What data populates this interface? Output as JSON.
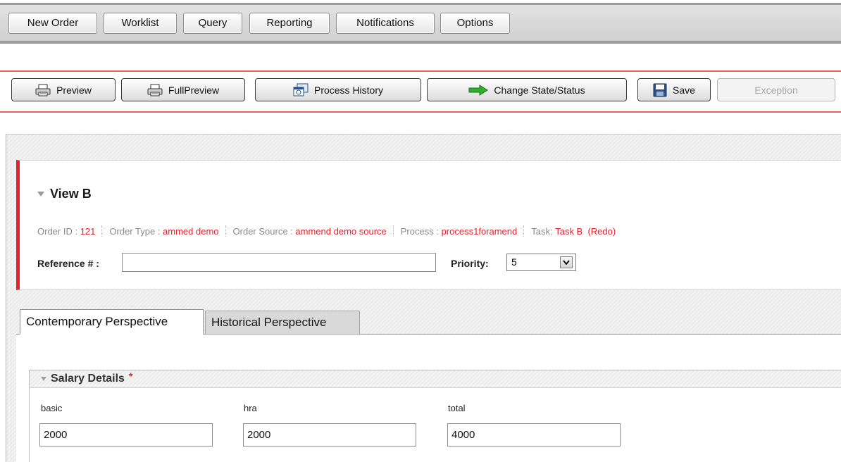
{
  "nav": {
    "tabs": [
      "New Order",
      "Worklist",
      "Query",
      "Reporting",
      "Notifications",
      "Options"
    ]
  },
  "toolbar": {
    "preview": "Preview",
    "full_preview": "FullPreview",
    "process_history": "Process History",
    "change_state": "Change State/Status",
    "save": "Save",
    "exception": "Exception"
  },
  "view": {
    "title": "View B",
    "order_id_label": "Order ID :",
    "order_id": "121",
    "order_type_label": "Order Type :",
    "order_type": "ammed demo",
    "order_source_label": "Order Source :",
    "order_source": "ammend demo source",
    "process_label": "Process :",
    "process": "process1foramend",
    "task_label": "Task:",
    "task": "Task B  (Redo)",
    "reference_label": "Reference # :",
    "reference_value": "",
    "priority_label": "Priority:",
    "priority_value": "5"
  },
  "tabs": {
    "contemporary": "Contemporary Perspective",
    "historical": "Historical Perspective"
  },
  "salary": {
    "title": "Salary Details",
    "required_mark": "*",
    "basic_label": "basic",
    "basic_value": "2000",
    "hra_label": "hra",
    "hra_value": "2000",
    "total_label": "total",
    "total_value": "4000"
  },
  "colors": {
    "accent_red": "#e8202a",
    "toolbar_line": "#e86262",
    "nav_bar": "#d8d8d8"
  }
}
